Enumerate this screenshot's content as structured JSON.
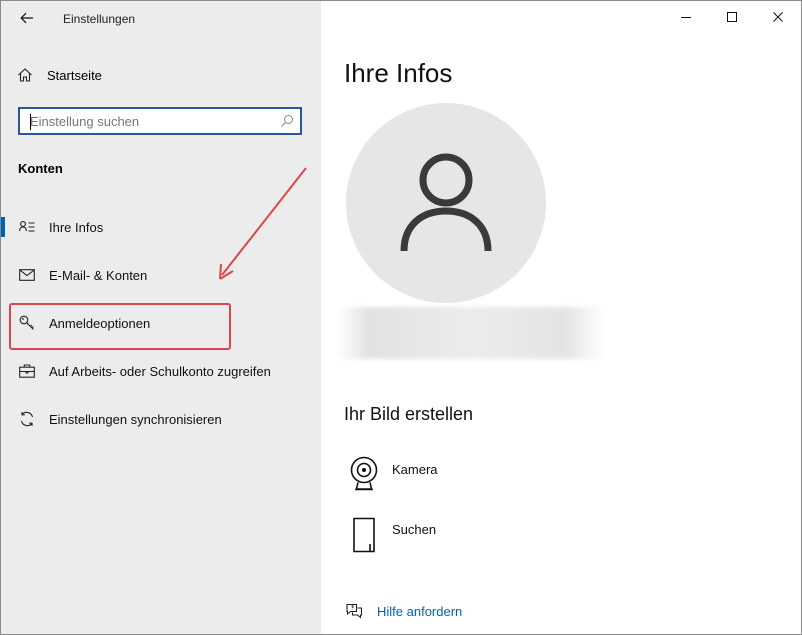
{
  "window": {
    "title": "Einstellungen",
    "controls": {
      "minimize": "minimize",
      "maximize": "maximize",
      "close": "close"
    }
  },
  "sidebar": {
    "home_label": "Startseite",
    "search": {
      "placeholder": "Einstellung suchen",
      "value": ""
    },
    "section_title": "Konten",
    "items": [
      {
        "label": "Ihre Infos",
        "icon": "person-card-icon",
        "selected": true
      },
      {
        "label": "E-Mail- & Konten",
        "icon": "mail-icon",
        "selected": false
      },
      {
        "label": "Anmeldeoptionen",
        "icon": "key-icon",
        "selected": false
      },
      {
        "label": "Auf Arbeits- oder Schulkonto zugreifen",
        "icon": "briefcase-icon",
        "selected": false
      },
      {
        "label": "Einstellungen synchronisieren",
        "icon": "sync-icon",
        "selected": false
      }
    ]
  },
  "main": {
    "title": "Ihre Infos",
    "create_picture": {
      "title": "Ihr Bild erstellen",
      "options": [
        {
          "label": "Kamera",
          "icon": "camera-icon"
        },
        {
          "label": "Suchen",
          "icon": "file-icon"
        }
      ]
    },
    "help_label": "Hilfe anfordern"
  },
  "colors": {
    "accent": "#0063b1",
    "annotation": "#d9474a",
    "sidebar_bg": "#ececec"
  }
}
